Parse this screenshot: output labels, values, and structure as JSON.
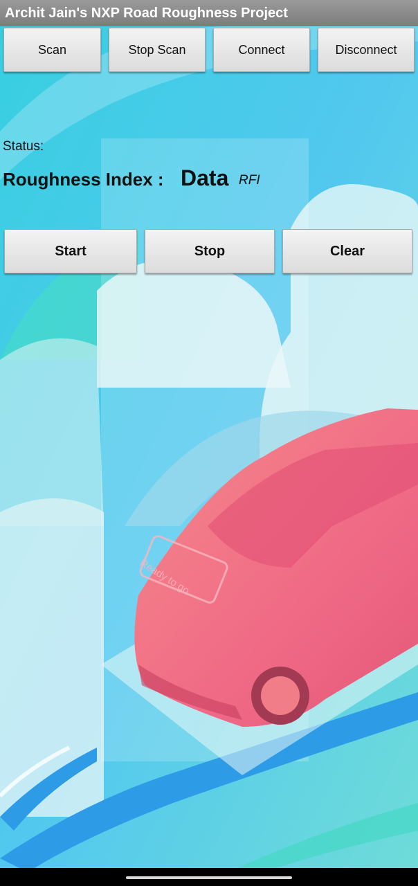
{
  "app": {
    "title": "Archit Jain's NXP Road Roughness Project"
  },
  "toolbar": {
    "scan": "Scan",
    "stop_scan": "Stop Scan",
    "connect": "Connect",
    "disconnect": "Disconnect"
  },
  "status": {
    "label": "Status:"
  },
  "roughness": {
    "label": "Roughness Index :",
    "value": "Data",
    "unit": "RFI"
  },
  "controls": {
    "start": "Start",
    "stop": "Stop",
    "clear": "Clear"
  },
  "illustration": {
    "sign_text": "Ready to go"
  }
}
